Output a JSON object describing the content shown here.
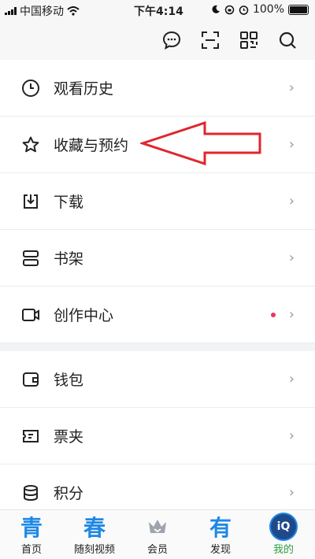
{
  "status_bar": {
    "carrier": "中国移动",
    "time": "下午4:14",
    "battery": "100%"
  },
  "toolbar": {
    "icons": [
      "message-icon",
      "scan-icon",
      "qrcode-icon",
      "search-icon"
    ]
  },
  "menu": {
    "group1": [
      {
        "label": "观看历史",
        "icon": "clock-icon"
      },
      {
        "label": "收藏与预约",
        "icon": "star-icon"
      },
      {
        "label": "下载",
        "icon": "download-icon"
      },
      {
        "label": "书架",
        "icon": "bookshelf-icon"
      },
      {
        "label": "创作中心",
        "icon": "camera-icon",
        "has_dot": true
      }
    ],
    "group2": [
      {
        "label": "钱包",
        "icon": "wallet-icon"
      },
      {
        "label": "票夹",
        "icon": "ticket-icon"
      },
      {
        "label": "积分",
        "icon": "coins-icon"
      }
    ],
    "chevron": "›",
    "dot_color": "#e8365e"
  },
  "annotation": {
    "color": "#e0262d",
    "shape": "arrow-left"
  },
  "tabbar": {
    "tabs": [
      {
        "label": "首页",
        "glyph": "青"
      },
      {
        "label": "随刻视频",
        "glyph": "春"
      },
      {
        "label": "会员",
        "glyph": ""
      },
      {
        "label": "发现",
        "glyph": "有"
      },
      {
        "label": "我的",
        "glyph": "iQ",
        "active": true
      }
    ],
    "active_color": "#2e9d41",
    "accent": "#1e88e5"
  }
}
